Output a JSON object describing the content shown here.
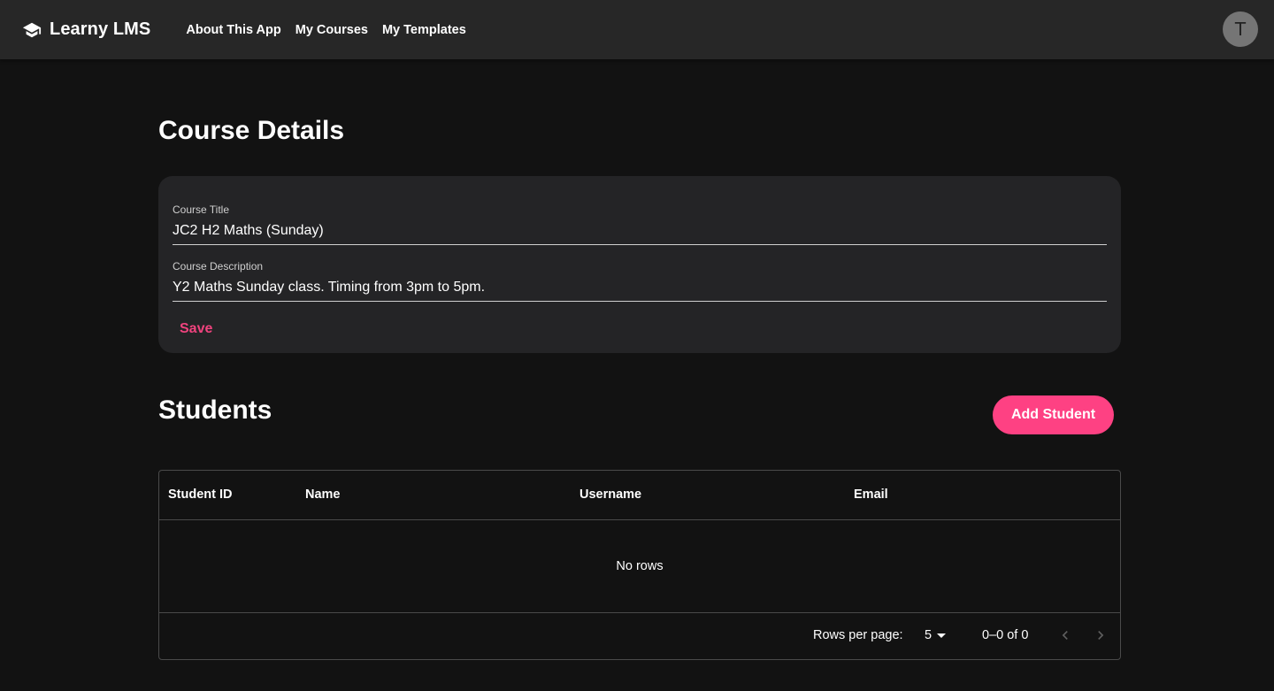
{
  "appbar": {
    "brand": "Learny LMS",
    "brand_icon": "graduation-cap-icon",
    "nav": [
      "About This App",
      "My Courses",
      "My Templates"
    ],
    "avatar_initial": "T"
  },
  "page": {
    "title": "Course Details"
  },
  "course_form": {
    "title_label": "Course Title",
    "title_value": "JC2 H2 Maths (Sunday)",
    "description_label": "Course Description",
    "description_value": "Y2 Maths Sunday class. Timing from 3pm to 5pm.",
    "save_label": "Save"
  },
  "students": {
    "section_title": "Students",
    "add_label": "Add Student",
    "columns": [
      "Student ID",
      "Name",
      "Username",
      "Email"
    ],
    "empty_text": "No rows",
    "rows_per_page_label": "Rows per page:",
    "rows_per_page": "5",
    "range": "0–0 of 0"
  },
  "colors": {
    "accent": "#fe4183",
    "background": "#121212",
    "appbar": "#272727",
    "card": "#242426"
  }
}
